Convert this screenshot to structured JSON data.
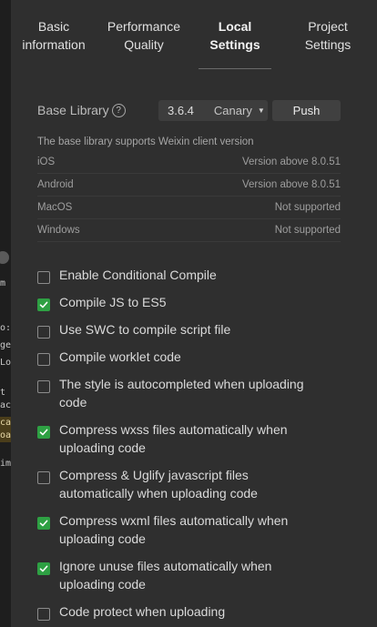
{
  "tabs": [
    {
      "label_1": "Basic",
      "label_2": "information"
    },
    {
      "label_1": "Performance",
      "label_2": "Quality"
    },
    {
      "label_1": "Local",
      "label_2": "Settings"
    },
    {
      "label_1": "Project",
      "label_2": "Settings"
    }
  ],
  "active_tab": 2,
  "base_library": {
    "label": "Base Library",
    "help_glyph": "?",
    "version": "3.6.4",
    "channel": "Canary",
    "push_label": "Push"
  },
  "support": {
    "note": "The base library supports Weixin client version",
    "rows": [
      {
        "os": "iOS",
        "value": "Version above 8.0.51"
      },
      {
        "os": "Android",
        "value": "Version above 8.0.51"
      },
      {
        "os": "MacOS",
        "value": "Not supported"
      },
      {
        "os": "Windows",
        "value": "Not supported"
      }
    ]
  },
  "options": [
    {
      "label": "Enable Conditional Compile",
      "checked": false
    },
    {
      "label": "Compile JS to ES5",
      "checked": true
    },
    {
      "label": "Use SWC to compile script file",
      "checked": false
    },
    {
      "label": "Compile worklet code",
      "checked": false
    },
    {
      "label": "The style is autocompleted when uploading code",
      "checked": false
    },
    {
      "label": "Compress wxss files automatically when uploading code",
      "checked": true
    },
    {
      "label": "Compress & Uglify javascript files automatically when uploading code",
      "checked": false
    },
    {
      "label": "Compress wxml files automatically when uploading code",
      "checked": true
    },
    {
      "label": "Ignore unuse files automatically when uploading code",
      "checked": true
    },
    {
      "label": "Code protect when uploading",
      "checked": false
    }
  ],
  "colors": {
    "panel_bg": "#2f2f2f",
    "checkbox_checked": "#2ea043",
    "text": "#dadada"
  },
  "left_strip": [
    {
      "text": "m",
      "highlight": false
    },
    {
      "text": "o:",
      "highlight": false
    },
    {
      "text": "ge",
      "highlight": false
    },
    {
      "text": "Lo",
      "highlight": false
    },
    {
      "text": "t",
      "highlight": false
    },
    {
      "text": "ac",
      "highlight": false
    },
    {
      "text": "ca",
      "highlight": true
    },
    {
      "text": "oa",
      "highlight": true
    },
    {
      "text": "im",
      "highlight": false
    }
  ]
}
